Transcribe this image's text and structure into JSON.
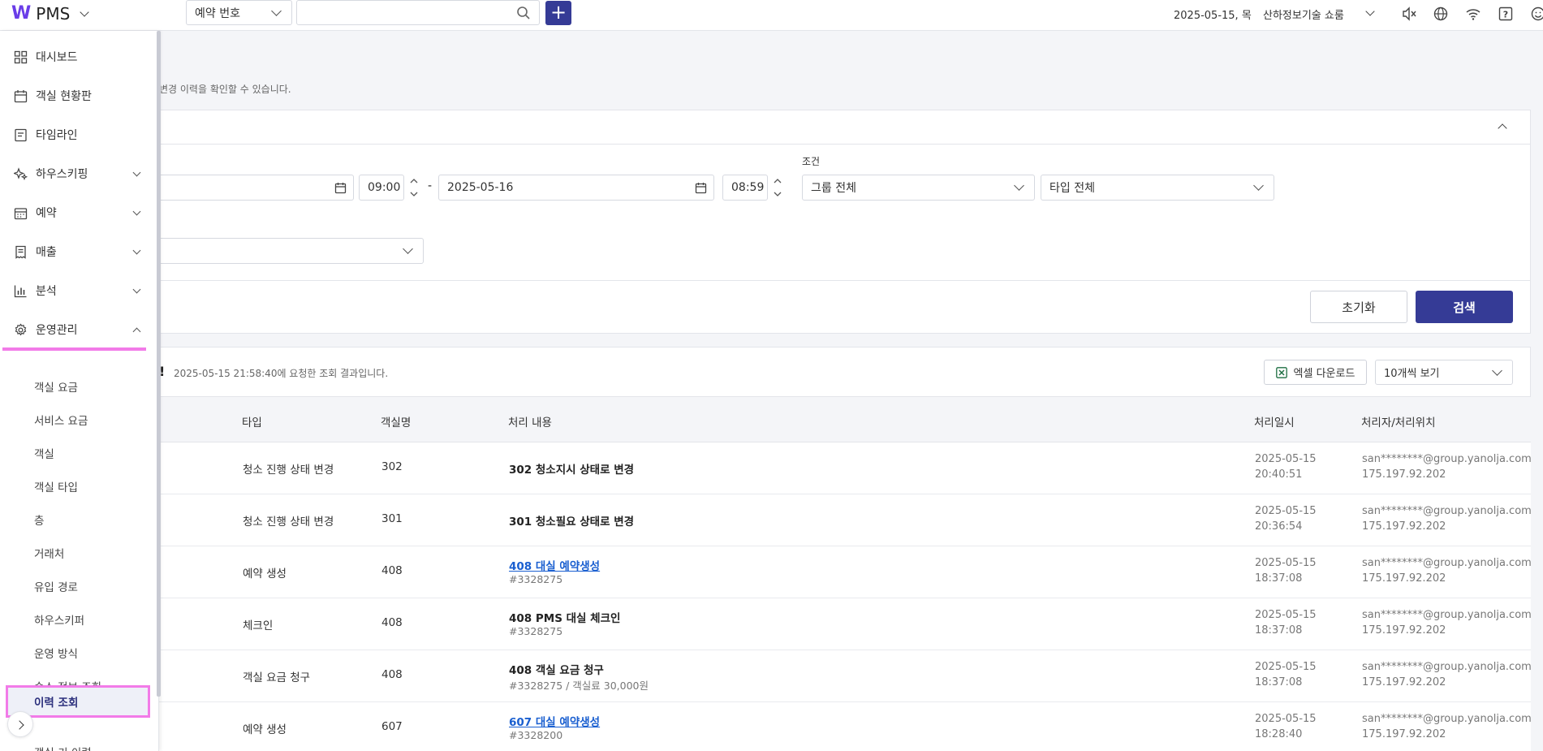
{
  "app": {
    "logo_mark": "W",
    "title": "PMS"
  },
  "search": {
    "type_select": "예약 번호",
    "query": "",
    "placeholder": ""
  },
  "header": {
    "date": "2025-05-15, 목",
    "property": "산하정보기술 쇼룸"
  },
  "icons": {
    "mute": "mute-icon",
    "globe": "globe-icon",
    "wifi": "wifi-icon",
    "help": "help-icon",
    "user": "user-icon"
  },
  "sidebar": {
    "items": [
      {
        "label": "대시보드",
        "icon": "dashboard-icon"
      },
      {
        "label": "객실 현황판",
        "icon": "calendar-icon"
      },
      {
        "label": "타임라인",
        "icon": "timeline-icon"
      },
      {
        "label": "하우스키핑",
        "icon": "sparkle-icon"
      },
      {
        "label": "예약",
        "icon": "calendar-grid-icon"
      },
      {
        "label": "매출",
        "icon": "receipt-icon"
      },
      {
        "label": "분석",
        "icon": "bar-chart-icon"
      },
      {
        "label": "운영관리",
        "icon": "gear-icon"
      }
    ],
    "sub_items": [
      "객실 요금",
      "서비스 요금",
      "객실",
      "객실 타입",
      "층",
      "거래처",
      "유입 경로",
      "하우스키퍼",
      "운영 방식",
      "숙소 정보 조회",
      "이력 조회",
      "객실 키 이력"
    ]
  },
  "page": {
    "description": "변경 이력을 확인할 수 있습니다."
  },
  "filters": {
    "start_time": "09:00",
    "end_date": "2025-05-16",
    "end_time": "08:59",
    "condition_label": "조건",
    "group_select": "그룹 전체",
    "type_select": "타입 전체",
    "reset_label": "초기화",
    "search_label": "검색"
  },
  "results": {
    "query_info": "2025-05-15 21:58:40에 요청한 조회 결과입니다.",
    "excel_label": "엑셀 다운로드",
    "page_size": "10개씩 보기"
  },
  "table": {
    "columns": [
      "타입",
      "객실명",
      "처리 내용",
      "처리일시",
      "처리자/처리위치"
    ],
    "rows": [
      {
        "type": "청소 진행 상태 변경",
        "room": "302",
        "content": "302 청소지시 상태로 변경",
        "detail": "",
        "link": false,
        "date": "2025-05-15",
        "time": "20:40:51",
        "user": "san********@group.yanolja.com",
        "ip": "175.197.92.202"
      },
      {
        "type": "청소 진행 상태 변경",
        "room": "301",
        "content": "301 청소필요 상태로 변경",
        "detail": "",
        "link": false,
        "date": "2025-05-15",
        "time": "20:36:54",
        "user": "san********@group.yanolja.com",
        "ip": "175.197.92.202"
      },
      {
        "type": "예약 생성",
        "room": "408",
        "content": "408 대실 예약생성",
        "detail": "#3328275",
        "link": true,
        "date": "2025-05-15",
        "time": "18:37:08",
        "user": "san********@group.yanolja.com",
        "ip": "175.197.92.202"
      },
      {
        "type": "체크인",
        "room": "408",
        "content": "408 PMS 대실 체크인",
        "detail": "#3328275",
        "link": false,
        "date": "2025-05-15",
        "time": "18:37:08",
        "user": "san********@group.yanolja.com",
        "ip": "175.197.92.202"
      },
      {
        "type": "객실 요금 청구",
        "room": "408",
        "content": "408 객실 요금 청구",
        "detail": "#3328275 / 객실료 30,000원",
        "link": false,
        "date": "2025-05-15",
        "time": "18:37:08",
        "user": "san********@group.yanolja.com",
        "ip": "175.197.92.202"
      },
      {
        "type": "예약 생성",
        "room": "607",
        "content": "607 대실 예약생성",
        "detail": "#3328200",
        "link": true,
        "date": "2025-05-15",
        "time": "18:28:40",
        "user": "san********@group.yanolja.com",
        "ip": "175.197.92.202"
      }
    ]
  },
  "colors": {
    "primary": "#353b96",
    "highlight": "#f27be8",
    "link": "#1a5fd0"
  }
}
